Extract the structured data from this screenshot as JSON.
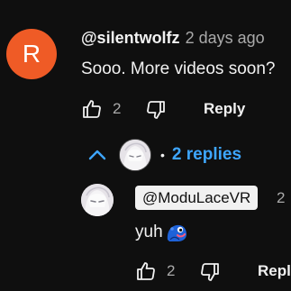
{
  "comment": {
    "avatar_letter": "R",
    "avatar_color": "#ef5b26",
    "username": "@silentwolfz",
    "timestamp": "2 days ago",
    "text": "Sooo. More videos soon?",
    "like_count": "2",
    "reply_label": "Reply"
  },
  "replies_toggle": {
    "chevron_icon": "chevron-up-icon",
    "separator": "•",
    "label": "2 replies",
    "color": "#3ea6ff"
  },
  "reply": {
    "username": "@ModuLaceVR",
    "timestamp": "2",
    "text": "yuh",
    "emoji_icon": "blue-creature-emoji-icon",
    "like_count": "2",
    "reply_label": "Reply"
  }
}
